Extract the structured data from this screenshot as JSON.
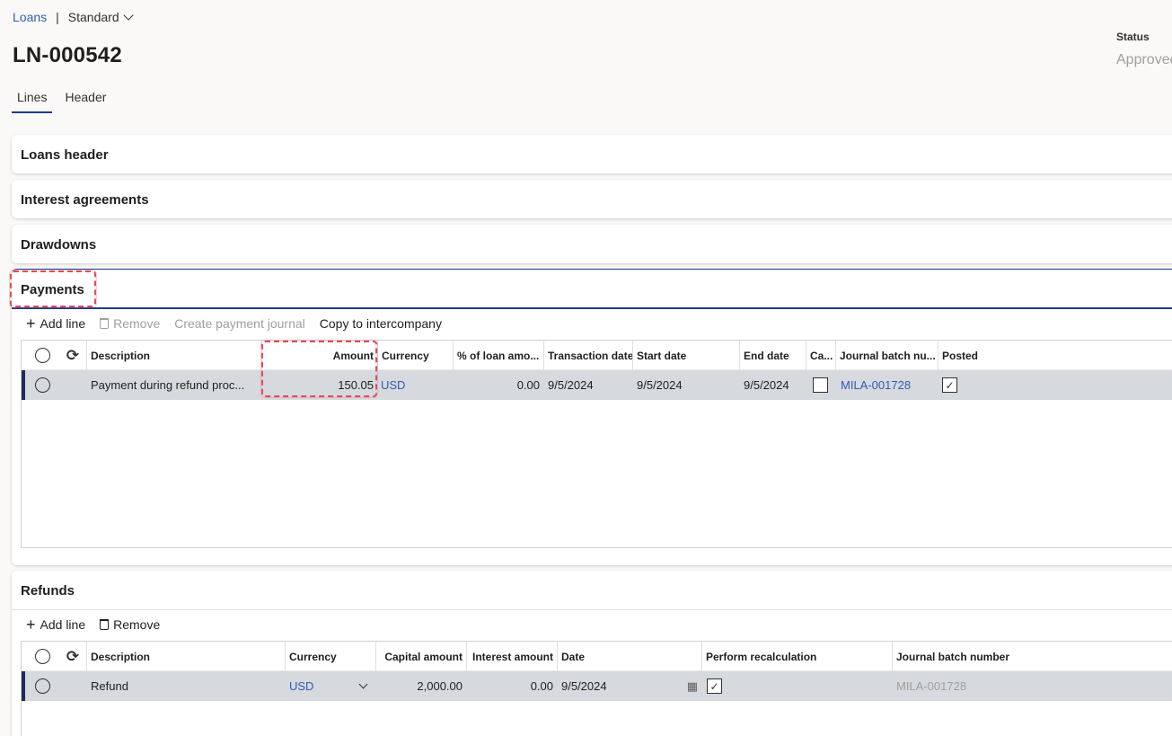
{
  "breadcrumb": {
    "module": "Loans",
    "separator": "|",
    "view": "Standard"
  },
  "page": {
    "title": "LN-000542"
  },
  "status": {
    "label": "Status",
    "value": "Approved"
  },
  "tabs": [
    {
      "label": "Lines",
      "active": true
    },
    {
      "label": "Header",
      "active": false
    }
  ],
  "sections": {
    "loans_header": "Loans header",
    "interest_agreements": "Interest agreements",
    "drawdowns": "Drawdowns",
    "payments": "Payments",
    "refunds": "Refunds"
  },
  "payments": {
    "toolbar": {
      "add_line": "Add line",
      "remove": "Remove",
      "create_payment_journal": "Create payment journal",
      "copy_to_intercompany": "Copy to intercompany"
    },
    "columns": {
      "description": "Description",
      "amount": "Amount",
      "currency": "Currency",
      "pct_loan": "% of loan amo...",
      "transaction_date": "Transaction date",
      "start_date": "Start date",
      "end_date": "End date",
      "ca": "Ca...",
      "journal_batch": "Journal batch nu...",
      "posted": "Posted"
    },
    "rows": [
      {
        "description": "Payment during refund proc...",
        "amount": "150.05",
        "currency": "USD",
        "pct_loan": "0.00",
        "transaction_date": "9/5/2024",
        "start_date": "9/5/2024",
        "end_date": "9/5/2024",
        "ca_checked": false,
        "journal_batch": "MILA-001728",
        "posted": true
      }
    ]
  },
  "refunds": {
    "toolbar": {
      "add_line": "Add line",
      "remove": "Remove"
    },
    "columns": {
      "description": "Description",
      "currency": "Currency",
      "capital_amount": "Capital amount",
      "interest_amount": "Interest amount",
      "date": "Date",
      "perform_recalculation": "Perform recalculation",
      "journal_batch": "Journal batch number"
    },
    "rows": [
      {
        "description": "Refund",
        "currency": "USD",
        "capital_amount": "2,000.00",
        "interest_amount": "0.00",
        "date": "9/5/2024",
        "perform_recalculation": true,
        "journal_batch": "MILA-001728"
      }
    ]
  },
  "icons": {
    "check": "✓",
    "refresh": "⟳",
    "calendar": "▦"
  },
  "colors": {
    "accent": "#1e3a8a",
    "link": "#2f5db3",
    "highlight": "#e34b5a",
    "selected_row": "#d6d9de"
  }
}
